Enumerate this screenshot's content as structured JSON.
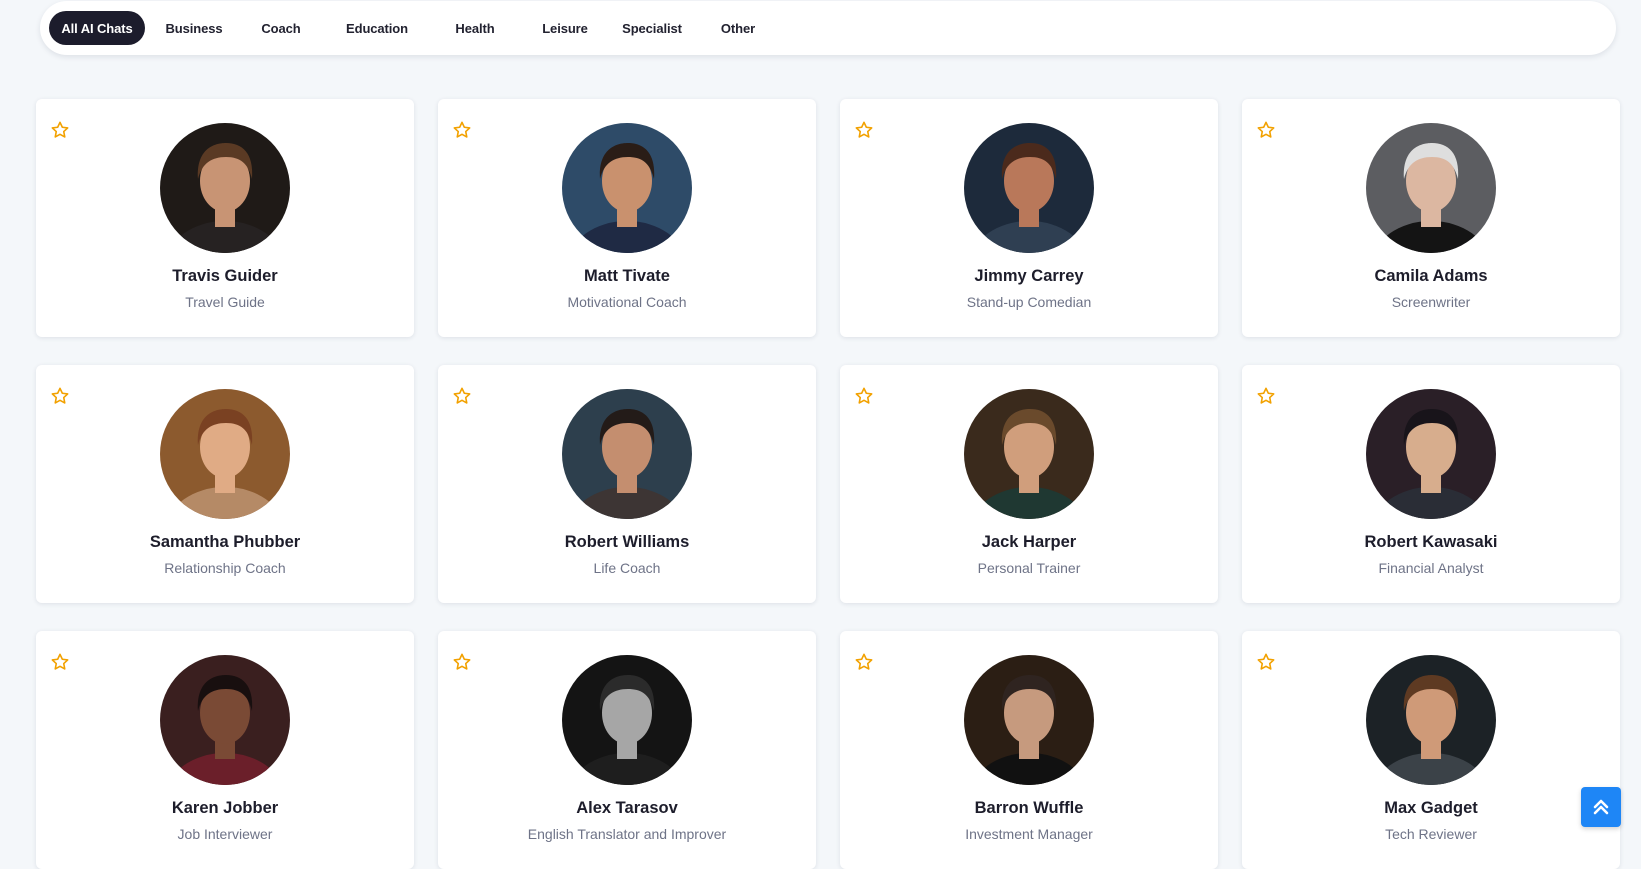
{
  "categories": [
    {
      "label": "All AI Chats",
      "active": true
    },
    {
      "label": "Business",
      "active": false
    },
    {
      "label": "Coach",
      "active": false
    },
    {
      "label": "Education",
      "active": false
    },
    {
      "label": "Health",
      "active": false
    },
    {
      "label": "Leisure",
      "active": false
    },
    {
      "label": "Specialist",
      "active": false
    },
    {
      "label": "Other",
      "active": false
    }
  ],
  "characters": [
    {
      "name": "Travis Guider",
      "role": "Travel Guide",
      "avatar": {
        "bg": "#1f1a17",
        "skin": "#c89474",
        "hair": "#5a3a24",
        "shirt": "#262222"
      }
    },
    {
      "name": "Matt Tivate",
      "role": "Motivational Coach",
      "avatar": {
        "bg": "#2e4b68",
        "skin": "#c9916e",
        "hair": "#2a1d17",
        "shirt": "#1f2a44"
      }
    },
    {
      "name": "Jimmy Carrey",
      "role": "Stand-up Comedian",
      "avatar": {
        "bg": "#1d2a3b",
        "skin": "#b9785a",
        "hair": "#4b2a1c",
        "shirt": "#2f3f52"
      }
    },
    {
      "name": "Camila Adams",
      "role": "Screenwriter",
      "avatar": {
        "bg": "#5c5d61",
        "skin": "#dcb7a1",
        "hair": "#dedede",
        "shirt": "#141414"
      }
    },
    {
      "name": "Samantha Phubber",
      "role": "Relationship Coach",
      "avatar": {
        "bg": "#8c5a2e",
        "skin": "#e0ab85",
        "hair": "#7a4122",
        "shirt": "#b58a66"
      }
    },
    {
      "name": "Robert Williams",
      "role": "Life Coach",
      "avatar": {
        "bg": "#2d3f4d",
        "skin": "#c48e6f",
        "hair": "#231b18",
        "shirt": "#3d3534"
      }
    },
    {
      "name": "Jack Harper",
      "role": "Personal Trainer",
      "avatar": {
        "bg": "#3a2a1c",
        "skin": "#d09e7c",
        "hair": "#6a4a2c",
        "shirt": "#1f3832"
      }
    },
    {
      "name": "Robert Kawasaki",
      "role": "Financial Analyst",
      "avatar": {
        "bg": "#2a1f27",
        "skin": "#d7ad8d",
        "hair": "#18141a",
        "shirt": "#2a2d36"
      }
    },
    {
      "name": "Karen Jobber",
      "role": "Job Interviewer",
      "avatar": {
        "bg": "#3a1f1f",
        "skin": "#7a4a35",
        "hair": "#180f0f",
        "shirt": "#6b1f2a"
      }
    },
    {
      "name": "Alex Tarasov",
      "role": "English Translator and Improver",
      "avatar": {
        "bg": "#141414",
        "skin": "#a6a6a6",
        "hair": "#2b2b2b",
        "shirt": "#1e1e1e"
      }
    },
    {
      "name": "Barron Wuffle",
      "role": "Investment Manager",
      "avatar": {
        "bg": "#2b1e14",
        "skin": "#c69a7e",
        "hair": "#2f2420",
        "shirt": "#111111"
      }
    },
    {
      "name": "Max Gadget",
      "role": "Tech Reviewer",
      "avatar": {
        "bg": "#1c2226",
        "skin": "#cf9a78",
        "hair": "#5e3a22",
        "shirt": "#3b4248"
      }
    }
  ],
  "colors": {
    "star": "#f2a100",
    "accent": "#1e86f6",
    "active_tab": "#1c1c2c"
  },
  "icons": {
    "favorite": "star-outline-icon",
    "scroll_top": "double-chevron-up-icon"
  }
}
